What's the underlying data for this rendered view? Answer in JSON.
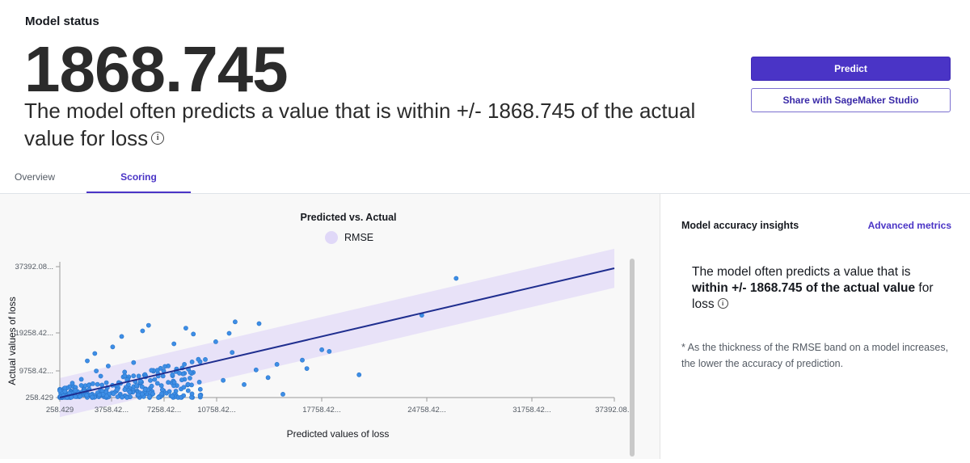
{
  "header": {
    "model_status_label": "Model status",
    "metric_value": "1868.745",
    "summary_text": "The model often predicts a value that is within +/- 1868.745 of the actual value for loss"
  },
  "actions": {
    "predict_label": "Predict",
    "share_label": "Share with SageMaker Studio"
  },
  "tabs": [
    {
      "label": "Overview",
      "active": false
    },
    {
      "label": "Scoring",
      "active": true
    }
  ],
  "insights": {
    "title": "Model accuracy insights",
    "advanced_link": "Advanced metrics",
    "text_prefix": "The model often predicts a value that is ",
    "text_bold": "within +/- 1868.745 of the actual value",
    "text_suffix": " for loss",
    "note": "* As the thickness of the RMSE band on a model increases, the lower the accuracy of prediction."
  },
  "colors": {
    "accent": "#4a34c6",
    "point": "#3d8ee6",
    "line": "#1f2e8f",
    "band": "#e3dcf7"
  },
  "chart_data": {
    "type": "scatter",
    "title": "Predicted vs. Actual",
    "legend": [
      "RMSE"
    ],
    "legend_placement": "top-center",
    "xlabel": "Predicted values of loss",
    "ylabel": "Actual values of loss",
    "x_ticks": [
      "258.429",
      "3758.42...",
      "7258.42...",
      "10758.42...",
      "17758.42...",
      "24758.42...",
      "31758.42...",
      "37392.08..."
    ],
    "y_ticks": [
      "258.429",
      "9758.42...",
      "19258.42...",
      "37392.08..."
    ],
    "xlim": [
      258.429,
      37392.08
    ],
    "ylim": [
      258.429,
      37392.08
    ],
    "rmse": 1868.745,
    "fit_line": [
      [
        258.429,
        258.429
      ],
      [
        37392.08,
        37392.08
      ]
    ],
    "grid": false,
    "points": [
      [
        26800,
        34500
      ],
      [
        24500,
        23900
      ],
      [
        20300,
        6800
      ],
      [
        18300,
        13500
      ],
      [
        17800,
        14000
      ],
      [
        16500,
        11000
      ],
      [
        14800,
        9800
      ],
      [
        13600,
        21500
      ],
      [
        12000,
        22000
      ],
      [
        11600,
        18700
      ],
      [
        10700,
        16300
      ],
      [
        9200,
        18500
      ],
      [
        8700,
        20200
      ],
      [
        7900,
        15700
      ],
      [
        6200,
        21000
      ],
      [
        5800,
        19400
      ],
      [
        4400,
        17800
      ],
      [
        3800,
        14800
      ],
      [
        2600,
        12900
      ],
      [
        2100,
        10800
      ],
      [
        15200,
        1200
      ],
      [
        13400,
        8200
      ],
      [
        12600,
        4000
      ],
      [
        11200,
        5200
      ],
      [
        9600,
        4700
      ],
      [
        8600,
        9800
      ],
      [
        7600,
        2000
      ],
      [
        6800,
        8100
      ],
      [
        5400,
        3700
      ],
      [
        4600,
        7600
      ],
      [
        3000,
        6400
      ],
      [
        2200,
        3800
      ],
      [
        1700,
        5500
      ],
      [
        1300,
        2300
      ],
      [
        900,
        1500
      ],
      [
        1100,
        4400
      ],
      [
        500,
        800
      ],
      [
        600,
        2000
      ],
      [
        2900,
        1000
      ],
      [
        4100,
        2500
      ],
      [
        10000,
        11200
      ],
      [
        9000,
        7500
      ],
      [
        7300,
        9200
      ],
      [
        6000,
        6200
      ],
      [
        5200,
        10300
      ],
      [
        3500,
        9300
      ],
      [
        2700,
        7900
      ],
      [
        11800,
        13200
      ],
      [
        14200,
        6000
      ],
      [
        16800,
        8600
      ]
    ]
  }
}
